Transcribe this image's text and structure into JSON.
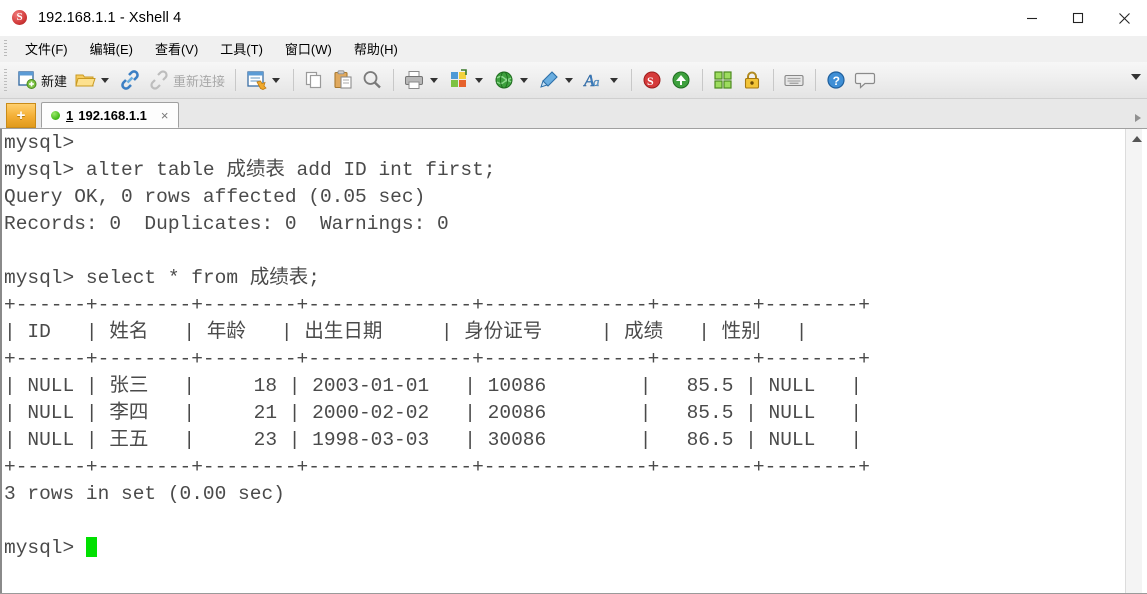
{
  "window": {
    "title": "192.168.1.1 - Xshell 4",
    "app_icon": "xshell-logo-icon",
    "minimize_label": "—",
    "maximize_label": "□",
    "close_label": "✕"
  },
  "menubar": {
    "items": [
      {
        "label": "文件(F)",
        "name": "menu-file"
      },
      {
        "label": "编辑(E)",
        "name": "menu-edit"
      },
      {
        "label": "查看(V)",
        "name": "menu-view"
      },
      {
        "label": "工具(T)",
        "name": "menu-tools"
      },
      {
        "label": "窗口(W)",
        "name": "menu-window"
      },
      {
        "label": "帮助(H)",
        "name": "menu-help"
      }
    ]
  },
  "toolbar": {
    "new_label": "新建",
    "reconnect_label": "重新连接",
    "icons": [
      "new-session-icon",
      "open-folder-icon",
      "connect-icon",
      "disconnect-icon",
      "session-manager-icon",
      "copy-icon",
      "paste-icon",
      "find-icon",
      "print-icon",
      "color-scheme-icon",
      "web-browser-icon",
      "highlight-icon",
      "font-icon",
      "xftp-icon",
      "xagent-icon",
      "layout-icon",
      "lock-icon",
      "keyboard-icon",
      "help-icon",
      "chat-icon"
    ],
    "overflow_label": "▼"
  },
  "tabbar": {
    "add_button_label": "+",
    "tab": {
      "index": "1",
      "title": "192.168.1.1",
      "close_label": "×",
      "status": "connected"
    }
  },
  "terminal": {
    "prompt": "mysql>",
    "lines": [
      "mysql>",
      "mysql> alter table 成绩表 add ID int first;",
      "Query OK, 0 rows affected (0.05 sec)",
      "Records: 0  Duplicates: 0  Warnings: 0",
      "",
      "mysql> select * from 成绩表;",
      "+------+--------+--------+--------------+--------------+--------+--------+",
      "| ID   | 姓名   | 年龄   | 出生日期     | 身份证号     | 成绩   | 性别   |",
      "+------+--------+--------+--------------+--------------+--------+--------+",
      "| NULL | 张三   |     18 | 2003-01-01   | 10086        |   85.5 | NULL   |",
      "| NULL | 李四   |     21 | 2000-02-02   | 20086        |   85.5 | NULL   |",
      "| NULL | 王五   |     23 | 1998-03-03   | 30086        |   86.5 | NULL   |",
      "+------+--------+--------+--------------+--------------+--------+--------+",
      "3 rows in set (0.00 sec)",
      "",
      "mysql> "
    ],
    "cursor_color": "#00e000",
    "foreground": "#4a4a4a",
    "background": "#ffffff"
  },
  "sql_table": {
    "statement": "select * from 成绩表;",
    "alter_statement": "alter table 成绩表 add ID int first;",
    "alter_result": "Query OK, 0 rows affected (0.05 sec)",
    "alter_records": "Records: 0  Duplicates: 0  Warnings: 0",
    "columns": [
      "ID",
      "姓名",
      "年龄",
      "出生日期",
      "身份证号",
      "成绩",
      "性别"
    ],
    "rows": [
      [
        "NULL",
        "张三",
        "18",
        "2003-01-01",
        "10086",
        "85.5",
        "NULL"
      ],
      [
        "NULL",
        "李四",
        "21",
        "2000-02-02",
        "20086",
        "85.5",
        "NULL"
      ],
      [
        "NULL",
        "王五",
        "23",
        "1998-03-03",
        "30086",
        "86.5",
        "NULL"
      ]
    ],
    "row_count_text": "3 rows in set (0.00 sec)"
  },
  "scrollbar": {
    "up_arrow_label": "▲"
  }
}
